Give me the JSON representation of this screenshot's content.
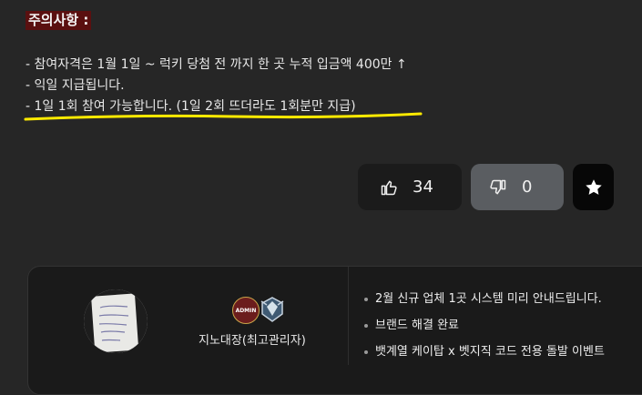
{
  "notice": {
    "title": "주의사항 :",
    "rules": [
      "- 참여자격은 1월 1일 ~ 럭키 당첨 전 까지 한 곳 누적 입금액 400만 ↑",
      "- 익일 지급됩니다.",
      "- 1일 1회 참여 가능합니다. (1일 2회 뜨더라도 1회분만 지급)"
    ],
    "highlight_color": "#ffea00"
  },
  "votes": {
    "like_count": "34",
    "dislike_count": "0"
  },
  "author": {
    "name": "지노대장(최고관리자)",
    "admin_badge": "ADMIN"
  },
  "recent_posts": [
    "2월 신규 업체 1곳 시스템 미리 안내드립니다.",
    "브랜드 해결 완료",
    "뱃계열 케이탑 x 벳지직 코드 전용 돌발 이벤트"
  ]
}
